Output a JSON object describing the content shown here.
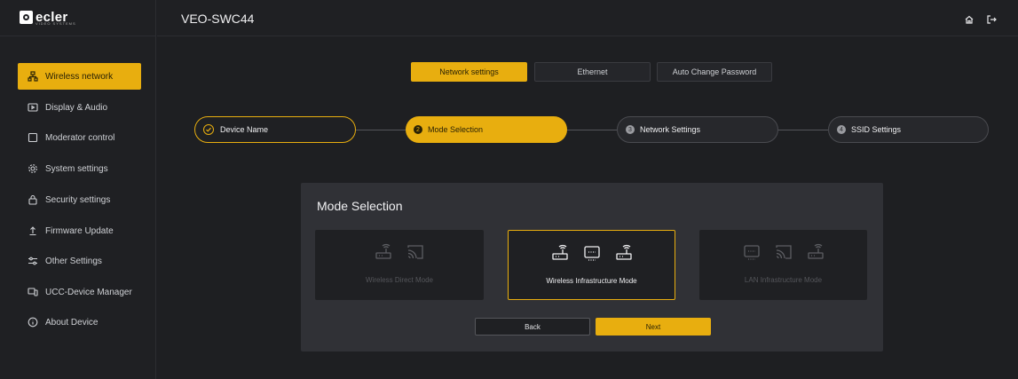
{
  "brand": {
    "name": "ecler",
    "sub": "VIDEO SYSTEMS"
  },
  "header": {
    "device_title": "VEO-SWC44",
    "home_icon": "home-icon",
    "logout_icon": "logout-icon"
  },
  "sidebar": {
    "items": [
      {
        "label": "Wireless network",
        "icon": "network-icon",
        "active": true
      },
      {
        "label": "Display & Audio",
        "icon": "display-icon",
        "active": false
      },
      {
        "label": "Moderator control",
        "icon": "square-icon",
        "active": false
      },
      {
        "label": "System settings",
        "icon": "gear-icon",
        "active": false
      },
      {
        "label": "Security settings",
        "icon": "lock-icon",
        "active": false
      },
      {
        "label": "Firmware Update",
        "icon": "upload-icon",
        "active": false
      },
      {
        "label": "Other Settings",
        "icon": "sliders-icon",
        "active": false
      },
      {
        "label": "UCC-Device Manager",
        "icon": "device-manager-icon",
        "active": false
      },
      {
        "label": "About Device",
        "icon": "info-icon",
        "active": false
      }
    ]
  },
  "tabs": [
    {
      "label": "Network settings",
      "active": true
    },
    {
      "label": "Ethernet",
      "active": false
    },
    {
      "label": "Auto Change Password",
      "active": false
    }
  ],
  "steps": [
    {
      "num": "",
      "label": "Device Name",
      "state": "done"
    },
    {
      "num": "2",
      "label": "Mode Selection",
      "state": "current"
    },
    {
      "num": "3",
      "label": "Network Settings",
      "state": "pending"
    },
    {
      "num": "4",
      "label": "SSID Settings",
      "state": "pending"
    }
  ],
  "panel": {
    "title": "Mode Selection",
    "modes": [
      {
        "label": "Wireless Direct Mode",
        "icons": [
          "router-icon",
          "cast-icon"
        ],
        "selected": false
      },
      {
        "label": "Wireless Infrastructure Mode",
        "icons": [
          "router-icon",
          "monitor-icon",
          "router-icon"
        ],
        "selected": true
      },
      {
        "label": "LAN Infrastructure Mode",
        "icons": [
          "monitor-icon",
          "cast-icon",
          "router-icon"
        ],
        "selected": false
      }
    ],
    "back_label": "Back",
    "next_label": "Next"
  },
  "colors": {
    "accent": "#e8ae0f",
    "background": "#1e1f22",
    "panel": "#303136"
  }
}
